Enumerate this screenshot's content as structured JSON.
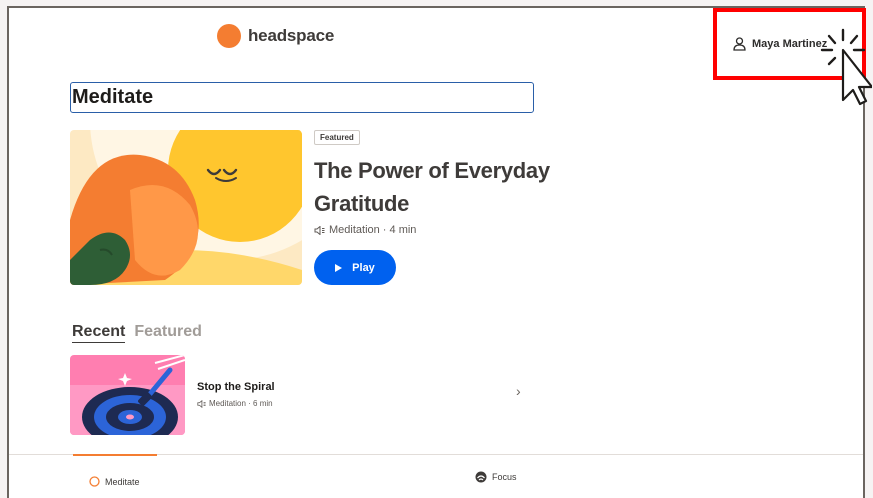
{
  "header": {
    "brand": "headspace",
    "user_name": "Maya Martinez"
  },
  "page": {
    "title": "Meditate"
  },
  "featured": {
    "badge": "Featured",
    "title": "The Power of Everyday Gratitude",
    "meta": "Meditation · 4 min",
    "play_label": "Play"
  },
  "tabs": [
    {
      "label": "Recent",
      "active": true
    },
    {
      "label": "Featured",
      "active": false
    }
  ],
  "recent_items": [
    {
      "title": "Stop the Spiral",
      "meta": "Meditation · 6 min"
    }
  ],
  "bottom_nav": {
    "meditate": "Meditate",
    "focus": "Focus"
  },
  "colors": {
    "brand_orange": "#f47d31",
    "play_blue": "#0061ef",
    "highlight_red": "#ff0000"
  }
}
